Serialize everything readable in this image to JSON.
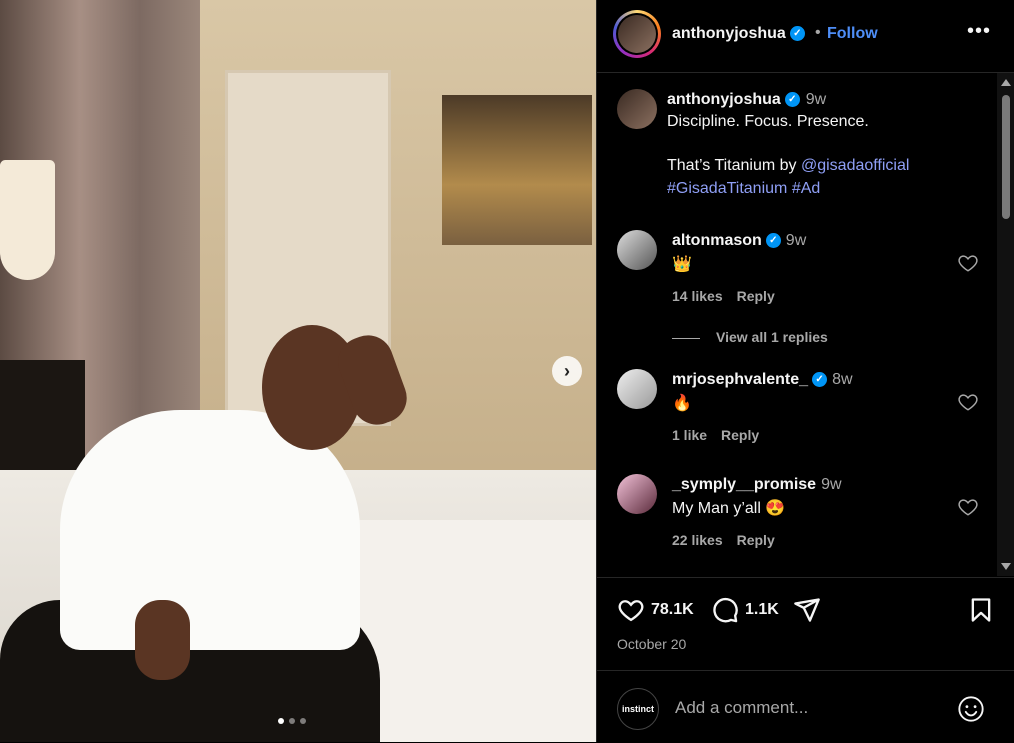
{
  "post": {
    "author": "anthonyjoshua",
    "follow_label": "Follow",
    "separator": "•",
    "more_label": "•••",
    "caption_time": "9w",
    "caption_line1": "Discipline. Focus. Presence.",
    "caption_line2_prefix": "That’s Titanium by ",
    "caption_mention": "@gisadaofficial",
    "caption_hashtag1": "#GisadaTitanium",
    "caption_hashtag2": "#Ad",
    "carousel_next": "›"
  },
  "comments": [
    {
      "user": "altonmason",
      "verified": true,
      "time": "9w",
      "text": "👑",
      "likes": "14 likes",
      "reply": "Reply"
    },
    {
      "user": "mrjosephvalente_",
      "verified": true,
      "time": "8w",
      "text": "🔥",
      "likes": "1 like",
      "reply": "Reply"
    },
    {
      "user": "_symply__promise",
      "verified": false,
      "time": "9w",
      "text": "My Man y’all 😍",
      "likes": "22 likes",
      "reply": "Reply"
    }
  ],
  "view_replies": "View all 1 replies",
  "actions": {
    "likes_count": "78.1K",
    "comments_count": "1.1K"
  },
  "date": "October 20",
  "add_comment": {
    "placeholder": "Add a comment...",
    "avatar_text": "instinct"
  },
  "colors": {
    "link": "#8f9ff5",
    "follow": "#4e8ef7",
    "verified": "#0095f6"
  }
}
